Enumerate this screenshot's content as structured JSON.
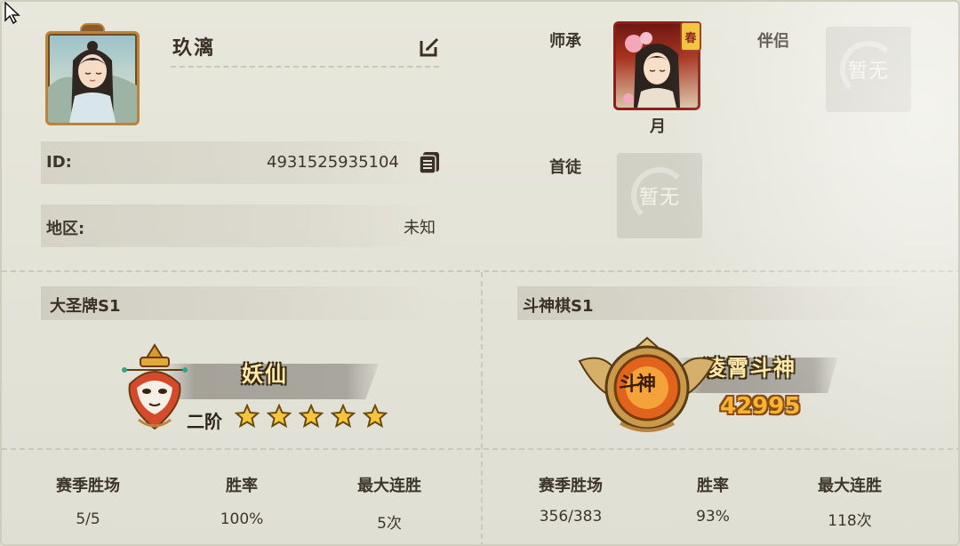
{
  "profile": {
    "name": "玖漓",
    "id_label": "ID:",
    "id_value": "4931525935104",
    "region_label": "地区:",
    "region_value": "未知"
  },
  "relations": {
    "mentor_label": "师承",
    "mentor_name": "月",
    "mentor_badge": "春",
    "partner_label": "伴侣",
    "partner_value": "暂无",
    "disciple_label": "首徒",
    "disciple_value": "暂无"
  },
  "modes": [
    {
      "title": "大圣牌S1",
      "rank_name": "妖仙",
      "tier": "二阶",
      "stars": 5,
      "stats": [
        {
          "label": "赛季胜场",
          "value": "5/5"
        },
        {
          "label": "胜率",
          "value": "100%"
        },
        {
          "label": "最大连胜",
          "value": "5次"
        }
      ]
    },
    {
      "title": "斗神棋S1",
      "rank_name": "凌霄斗神",
      "emblem_text": "斗神",
      "score": "42995",
      "stats": [
        {
          "label": "赛季胜场",
          "value": "356/383"
        },
        {
          "label": "胜率",
          "value": "93%"
        },
        {
          "label": "最大连胜",
          "value": "118次"
        }
      ]
    }
  ],
  "colors": {
    "panel_bg": "#e4e3d8",
    "gold": "#f6b531",
    "rank_text": "#ffe9a8",
    "frame_gold": "#b8843e"
  },
  "icons": [
    "cursor-icon",
    "edit-icon",
    "copy-icon",
    "star-icon",
    "monkey-king-rank-icon",
    "dou-shen-emblem-icon"
  ]
}
